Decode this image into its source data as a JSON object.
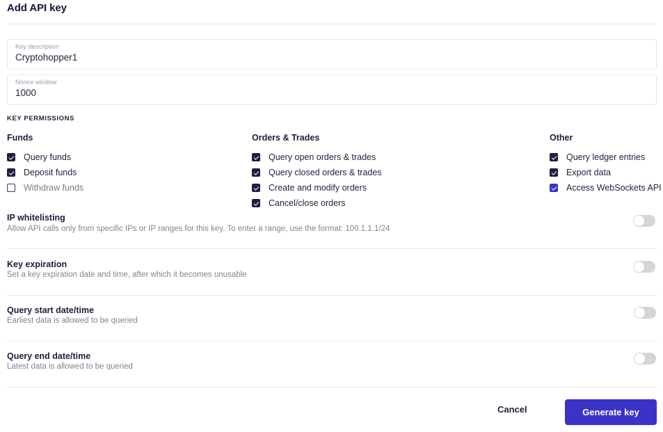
{
  "header": {
    "title": "Add API key"
  },
  "fields": [
    {
      "label": "Key description",
      "value": "Cryptohopper1",
      "placeholder": "Key description"
    },
    {
      "label": "Nonce window",
      "value": "1000",
      "placeholder": "Nonce window"
    }
  ],
  "permissions": {
    "kicker": "KEY PERMISSIONS",
    "columns": [
      {
        "title": "Funds",
        "items": [
          {
            "label": "Query funds",
            "checked": true,
            "style": "dark"
          },
          {
            "label": "Deposit funds",
            "checked": true,
            "style": "dark"
          },
          {
            "label": "Withdraw funds",
            "checked": false,
            "style": "dark"
          }
        ]
      },
      {
        "title": "Orders & Trades",
        "items": [
          {
            "label": "Query open orders & trades",
            "checked": true,
            "style": "dark"
          },
          {
            "label": "Query closed orders & trades",
            "checked": true,
            "style": "dark"
          },
          {
            "label": "Create and modify orders",
            "checked": true,
            "style": "dark"
          },
          {
            "label": "Cancel/close orders",
            "checked": true,
            "style": "dark"
          }
        ]
      },
      {
        "title": "Other",
        "items": [
          {
            "label": "Query ledger entries",
            "checked": true,
            "style": "dark"
          },
          {
            "label": "Export data",
            "checked": true,
            "style": "dark"
          },
          {
            "label": "Access WebSockets API",
            "checked": true,
            "style": "accent"
          }
        ]
      }
    ]
  },
  "settings": [
    {
      "name": "ip-whitelisting",
      "heading": "IP whitelisting",
      "description": "Allow API calls only from specific IPs or IP ranges for this key. To enter a range, use the format: 100.1.1.1/24",
      "enabled": false
    },
    {
      "name": "key-expiration",
      "heading": "Key expiration",
      "description": "Set a key expiration date and time, after which it becomes unusable",
      "enabled": false
    },
    {
      "name": "query-start-datetime",
      "heading": "Query start date/time",
      "description": "Earliest data is allowed to be queried",
      "enabled": false
    },
    {
      "name": "query-end-datetime",
      "heading": "Query end date/time",
      "description": "Latest data is allowed to be queried",
      "enabled": false
    }
  ],
  "footer": {
    "cancel_label": "Cancel",
    "generate_label": "Generate key"
  },
  "colors": {
    "accent": "#3b32c8",
    "checkbox_dark": "#1e1e3f",
    "text": "#1b1b38",
    "muted": "#83848f",
    "divider": "#e6e7ea",
    "toggle_track": "#d4d5d9"
  }
}
